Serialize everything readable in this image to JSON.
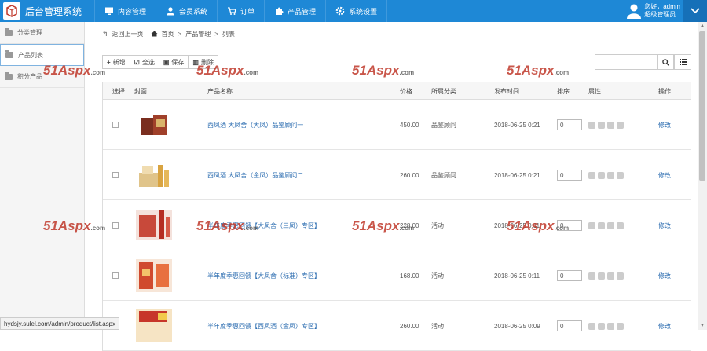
{
  "app": {
    "title": "后台管理系统"
  },
  "nav": [
    {
      "label": "内容管理",
      "icon": "monitor-icon"
    },
    {
      "label": "会员系统",
      "icon": "user-icon"
    },
    {
      "label": "订单",
      "icon": "cart-icon"
    },
    {
      "label": "产品管理",
      "icon": "puzzle-icon"
    },
    {
      "label": "系统设置",
      "icon": "gear-icon"
    }
  ],
  "user": {
    "greeting": "您好，admin",
    "role": "超级管理员"
  },
  "sidebar": {
    "items": [
      {
        "label": "分类管理"
      },
      {
        "label": "产品列表"
      },
      {
        "label": "积分产品"
      }
    ]
  },
  "breadcrumb": {
    "back": "返回上一页",
    "home": "首页",
    "section": "产品管理",
    "current": "列表",
    "sep": ">"
  },
  "toolbar": {
    "add": "新增",
    "select_all": "全选",
    "save": "保存",
    "delete": "删除"
  },
  "search": {
    "value": ""
  },
  "table": {
    "headers": {
      "select": "选择",
      "cover": "封面",
      "name": "产品名称",
      "price": "价格",
      "category": "所属分类",
      "time": "发布时间",
      "sort": "排序",
      "attrs": "属性",
      "op": "操作"
    },
    "rows": [
      {
        "name": "西凤酒 大凤舍（大凤）品鉴顾问一",
        "price": "450.00",
        "category": "品鉴顾问",
        "time": "2018-06-25 0:21",
        "sort": "0",
        "op": "修改"
      },
      {
        "name": "西凤酒 大凤舍（金凤）品鉴顾问二",
        "price": "260.00",
        "category": "品鉴顾问",
        "time": "2018-06-25 0:21",
        "sort": "0",
        "op": "修改"
      },
      {
        "name": "半年度季惠回馈【大凤舍（三凤）专区】",
        "price": "228.00",
        "category": "活动",
        "time": "2018-06-25 0:11",
        "sort": "0",
        "op": "修改"
      },
      {
        "name": "半年度季惠回馈【大凤舍（标准）专区】",
        "price": "168.00",
        "category": "活动",
        "time": "2018-06-25 0:11",
        "sort": "0",
        "op": "修改"
      },
      {
        "name": "半年度季惠回馈【西凤酒（金凤）专区】",
        "price": "260.00",
        "category": "活动",
        "time": "2018-06-25 0:09",
        "sort": "0",
        "op": "修改"
      }
    ]
  },
  "watermark": {
    "text": "51Aspx",
    "suffix": ".com"
  },
  "status": {
    "url": "hydsjy.sulel.com/admin/product/list.aspx"
  }
}
